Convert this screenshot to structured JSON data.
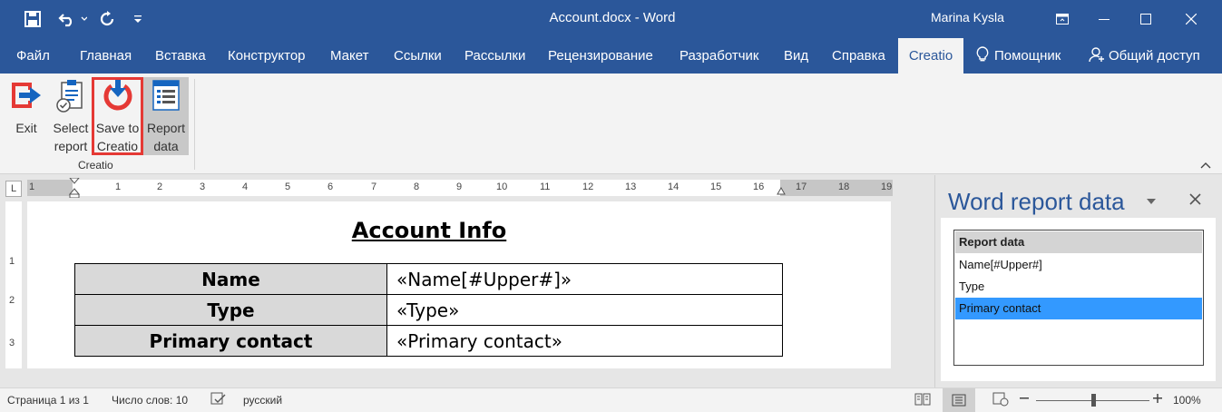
{
  "window": {
    "document_title": "Account.docx  -  Word",
    "user": "Marina Kysla"
  },
  "tabs": [
    {
      "label": "Файл"
    },
    {
      "label": "Главная"
    },
    {
      "label": "Вставка"
    },
    {
      "label": "Конструктор"
    },
    {
      "label": "Макет"
    },
    {
      "label": "Ссылки"
    },
    {
      "label": "Рассылки"
    },
    {
      "label": "Рецензирование"
    },
    {
      "label": "Разработчик"
    },
    {
      "label": "Вид"
    },
    {
      "label": "Справка"
    },
    {
      "label": "Creatio"
    }
  ],
  "tabs_right": {
    "assistant": "Помощник",
    "share": "Общий доступ"
  },
  "ribbon": {
    "buttons": [
      {
        "line1": "Exit",
        "line2": ""
      },
      {
        "line1": "Select",
        "line2": "report"
      },
      {
        "line1": "Save to",
        "line2": "Creatio"
      },
      {
        "line1": "Report",
        "line2": "data"
      }
    ],
    "group_label": "Creatio"
  },
  "ruler": {
    "corner": "L",
    "numbers": [
      "1",
      "1",
      "2",
      "3",
      "4",
      "5",
      "6",
      "7",
      "8",
      "9",
      "10",
      "11",
      "12",
      "13",
      "14",
      "15",
      "16",
      "17",
      "18",
      "19"
    ],
    "vertical_numbers": [
      "1",
      "2",
      "3"
    ]
  },
  "document": {
    "title": "Account Info",
    "rows": [
      {
        "key": "Name",
        "value": "«Name[#Upper#]»"
      },
      {
        "key": "Type",
        "value": "«Type»"
      },
      {
        "key": "Primary contact",
        "value": "«Primary contact»"
      }
    ]
  },
  "pane": {
    "title": "Word report data",
    "list_header": "Report data",
    "items": [
      {
        "label": "Name[#Upper#]",
        "selected": false
      },
      {
        "label": "Type",
        "selected": false
      },
      {
        "label": "Primary contact",
        "selected": true
      }
    ]
  },
  "status": {
    "page": "Страница 1 из 1",
    "words": "Число слов: 10",
    "language": "русский",
    "zoom": "100%"
  },
  "colors": {
    "brand": "#2b579a",
    "highlight": "#e53935",
    "selection": "#3399ff"
  }
}
